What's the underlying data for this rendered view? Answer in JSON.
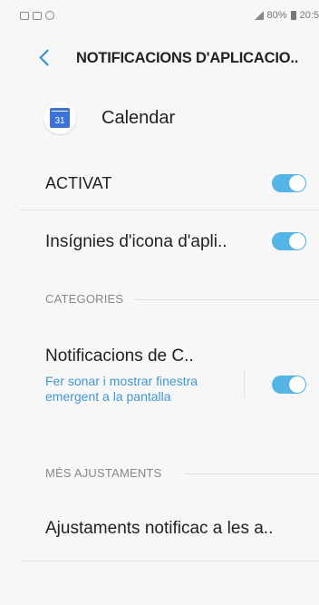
{
  "status_bar": {
    "battery": "80%",
    "time": "20:5"
  },
  "app_bar": {
    "title": "NOTIFICACIONS D'APLICACIO.."
  },
  "app": {
    "name": "Calendar",
    "icon_day": "31",
    "icon": "calendar-icon"
  },
  "settings": {
    "activat": {
      "label": "ACTIVAT",
      "enabled": true
    },
    "badges": {
      "label": "Insígnies d'icona d'apli..",
      "enabled": true
    }
  },
  "categories": {
    "header": "CATEGORIES",
    "item": {
      "title": "Notificacions de C..",
      "subtitle": "Fer sonar i mostrar finestra emergent a la pantalla",
      "enabled": true
    }
  },
  "more": {
    "header": "MÉS AJUSTAMENTS",
    "item_label": "Ajustaments notificac a les a.."
  },
  "colors": {
    "accent": "#54b4e6",
    "link": "#3f97d4"
  }
}
